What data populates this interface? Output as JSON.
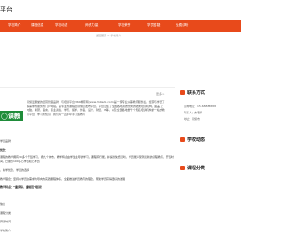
{
  "header": {
    "title": "平台"
  },
  "nav": {
    "items": [
      "学校简介",
      "课程信息",
      "学校动态",
      "师资力量",
      "学校荣誉",
      "学员答疑",
      "免费试听"
    ],
    "bg_color": "#e84a1b"
  },
  "breadcrumb": "返回首页 > 学校简介",
  "intro": {
    "more": "更多 >",
    "logo_text": "◯课教育",
    "text": "恩施爱课堂的经营管理品牌，与培训平台 360教育网(www.360edu.com)是一家专业从事教育服务业，经营与学员了解需求的服务的门户网站。是专业的课程培训信息发布平台，平台汇集了全国各地资质优秀的各类培训机构，涵盖了：电脑、考研、语言、职业资格、学历、留学、外语、设计、财经、IT等，以及全国各地数千个知名培训机构的一站式教育平台，学习新知识，我们将一直手牵手打造教育"
  },
  "body_lines": [
    "学员品牌",
    "优势：",
    "课程的教学拥有30多个开班学习，按九个城市，教学特点由学生主导的学习，课程有行能，并提供免费试听，学员能享受到最新的课程教育，开班时间，已服务100多万学员和万学员",
    "，教学优势，学员的选择",
    "教学理念：坚持以学员的需求为导向的实践课程体系，全面推进学员教育的理念，帮助学员获得更好的发展",
    "教学特点：“重实际、重规范”培训！"
  ],
  "bottom_lines": [
    "信息",
    "课程分类",
    "开课时间",
    "学校简介"
  ],
  "sidebar": {
    "contact_title": "联系方式",
    "contact_lines": [
      "咨询电话：15168888888",
      "联系人：方老师",
      "地址：恩施市"
    ],
    "news_title": "学校动态",
    "courses_title": "课程分类"
  }
}
